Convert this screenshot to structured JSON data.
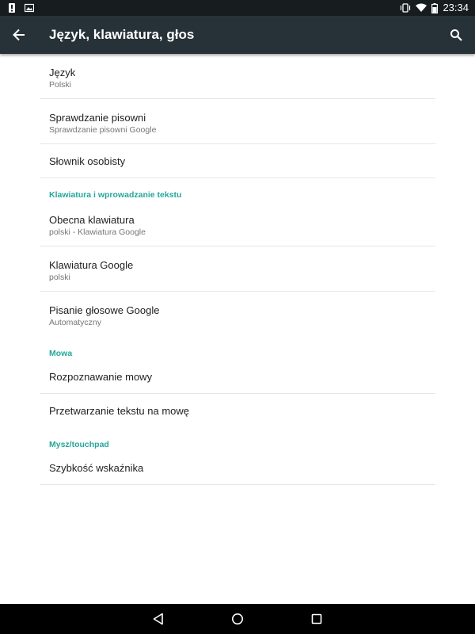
{
  "status_bar": {
    "time": "23:34",
    "left_icons": [
      "notification-alert-icon",
      "image-notification-icon"
    ],
    "right_icons": [
      "vibrate-icon",
      "wifi-icon",
      "battery-icon"
    ]
  },
  "app_bar": {
    "title": "Język, klawiatura, głos",
    "back_icon": "arrow-back-icon",
    "search_icon": "search-icon",
    "color": "#263238"
  },
  "accent_color": "#26a69a",
  "groups": {
    "general": [
      {
        "title": "Język",
        "subtitle": "Polski"
      },
      {
        "title": "Sprawdzanie pisowni",
        "subtitle": "Sprawdzanie pisowni Google"
      },
      {
        "title": "Słownik osobisty"
      }
    ],
    "keyboard": {
      "header": "Klawiatura i wprowadzanie tekstu",
      "items": [
        {
          "title": "Obecna klawiatura",
          "subtitle": "polski - Klawiatura Google"
        },
        {
          "title": "Klawiatura Google",
          "subtitle": "polski"
        },
        {
          "title": "Pisanie głosowe Google",
          "subtitle": "Automatyczny"
        }
      ]
    },
    "speech": {
      "header": "Mowa",
      "items": [
        {
          "title": "Rozpoznawanie mowy"
        },
        {
          "title": "Przetwarzanie tekstu na mowę"
        }
      ]
    },
    "mouse": {
      "header": "Mysz/touchpad",
      "items": [
        {
          "title": "Szybkość wskaźnika"
        }
      ]
    }
  },
  "nav_bar": {
    "buttons": [
      "back-triangle-icon",
      "home-circle-icon",
      "recents-square-icon"
    ]
  }
}
